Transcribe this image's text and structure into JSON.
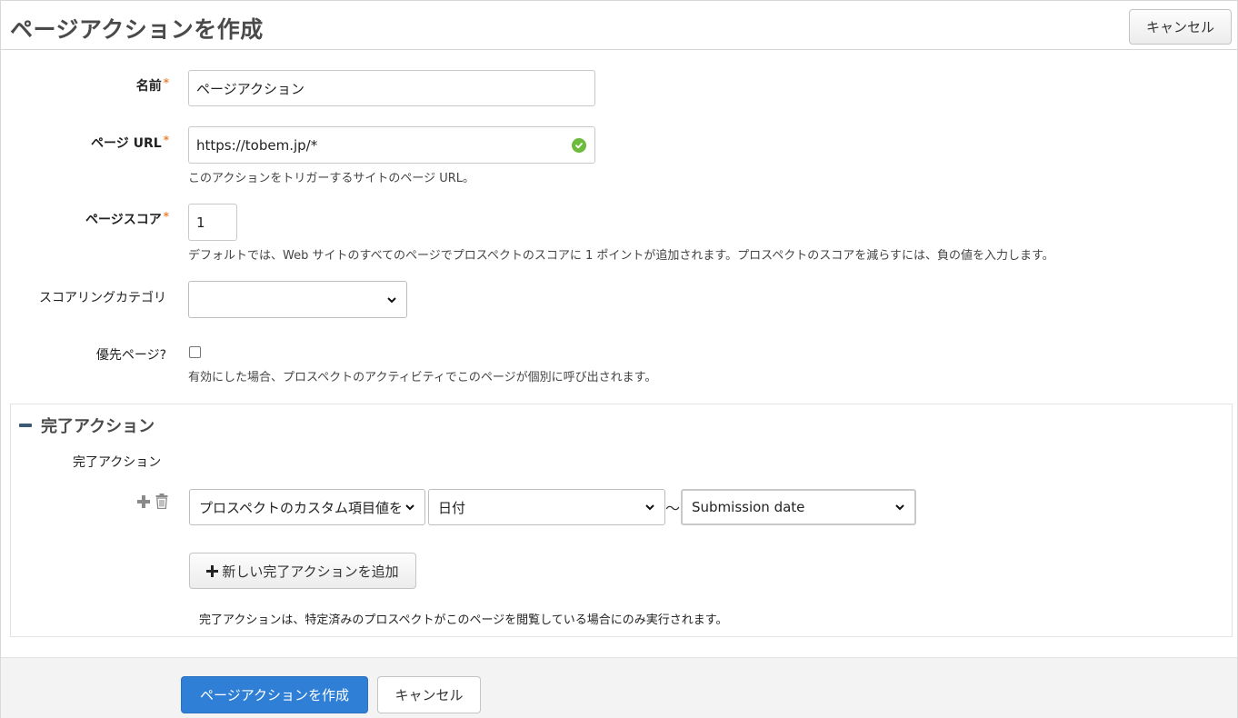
{
  "header": {
    "title": "ページアクションを作成",
    "cancel_label": "キャンセル"
  },
  "form": {
    "name": {
      "label": "名前",
      "required_mark": "*",
      "value": "ページアクション"
    },
    "page_url": {
      "label": "ページ URL",
      "required_mark": "*",
      "value": "https://tobem.jp/*",
      "help": "このアクションをトリガーするサイトのページ URL。",
      "status_icon": "check-circle-icon"
    },
    "page_score": {
      "label": "ページスコア",
      "required_mark": "*",
      "value": "1",
      "help": "デフォルトでは、Web サイトのすべてのページでプロスペクトのスコアに 1 ポイントが追加されます。プロスペクトのスコアを減らすには、負の値を入力します。"
    },
    "scoring_category": {
      "label": "スコアリングカテゴリ",
      "value": ""
    },
    "priority_page": {
      "label": "優先ページ?",
      "checked": false,
      "help": "有効にした場合、プロスペクトのアクティビティでこのページが個別に呼び出されます。"
    }
  },
  "completion": {
    "section_title": "完了アクション",
    "field_label": "完了アクション",
    "action_select": "プロスペクトのカスタム項目値を",
    "field_select": "日付",
    "separator": "〜",
    "value_select": "Submission date",
    "add_label": "新しい完了アクションを追加",
    "note": "完了アクションは、特定済みのプロスペクトがこのページを閲覧している場合にのみ実行されます。"
  },
  "footer": {
    "create_label": "ページアクションを作成",
    "cancel_label": "キャンセル"
  },
  "colors": {
    "primary": "#2f7fd6",
    "required": "#e8833a",
    "success": "#6cbb3c",
    "section_icon": "#3d5a75"
  }
}
